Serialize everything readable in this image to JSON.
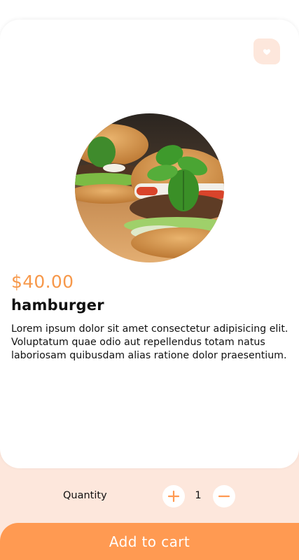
{
  "product": {
    "price": "$40.00",
    "name": "hamburger",
    "description": "Lorem ipsum dolor sit amet consectetur adipisicing elit. Voluptatum quae odio aut repellendus totam natus laboriosam quibusdam alias ratione dolor praesentium.",
    "image_icon": "hamburger-photo"
  },
  "favorite": {
    "icon": "heart-icon"
  },
  "quantity": {
    "label": "Quantity",
    "value": "1",
    "increment_icon": "plus-icon",
    "decrement_icon": "minus-icon"
  },
  "cart": {
    "button_label": "Add to cart"
  },
  "colors": {
    "accent": "#ff9a52",
    "price": "#f7984a",
    "peach": "#fde7dc",
    "text": "#111111"
  }
}
